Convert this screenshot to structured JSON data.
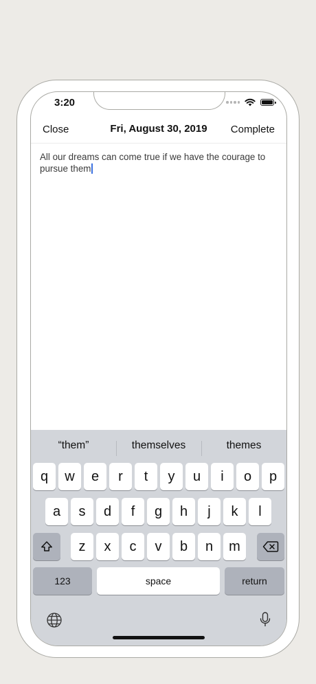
{
  "status_bar": {
    "time": "3:20"
  },
  "nav": {
    "close_label": "Close",
    "title": "Fri, August 30, 2019",
    "complete_label": "Complete"
  },
  "note": {
    "text": "All our dreams can come true if we have the courage to pursue them"
  },
  "keyboard": {
    "suggestions": [
      "“them”",
      "themselves",
      "themes"
    ],
    "row1": [
      "q",
      "w",
      "e",
      "r",
      "t",
      "y",
      "u",
      "i",
      "o",
      "p"
    ],
    "row2": [
      "a",
      "s",
      "d",
      "f",
      "g",
      "h",
      "j",
      "k",
      "l"
    ],
    "row3": [
      "z",
      "x",
      "c",
      "v",
      "b",
      "n",
      "m"
    ],
    "numbers_label": "123",
    "space_label": "space",
    "return_label": "return"
  },
  "colors": {
    "cursor": "#3b71e0",
    "keyboard_bg": "#d2d5da",
    "dark_key": "#aeb2bb"
  }
}
